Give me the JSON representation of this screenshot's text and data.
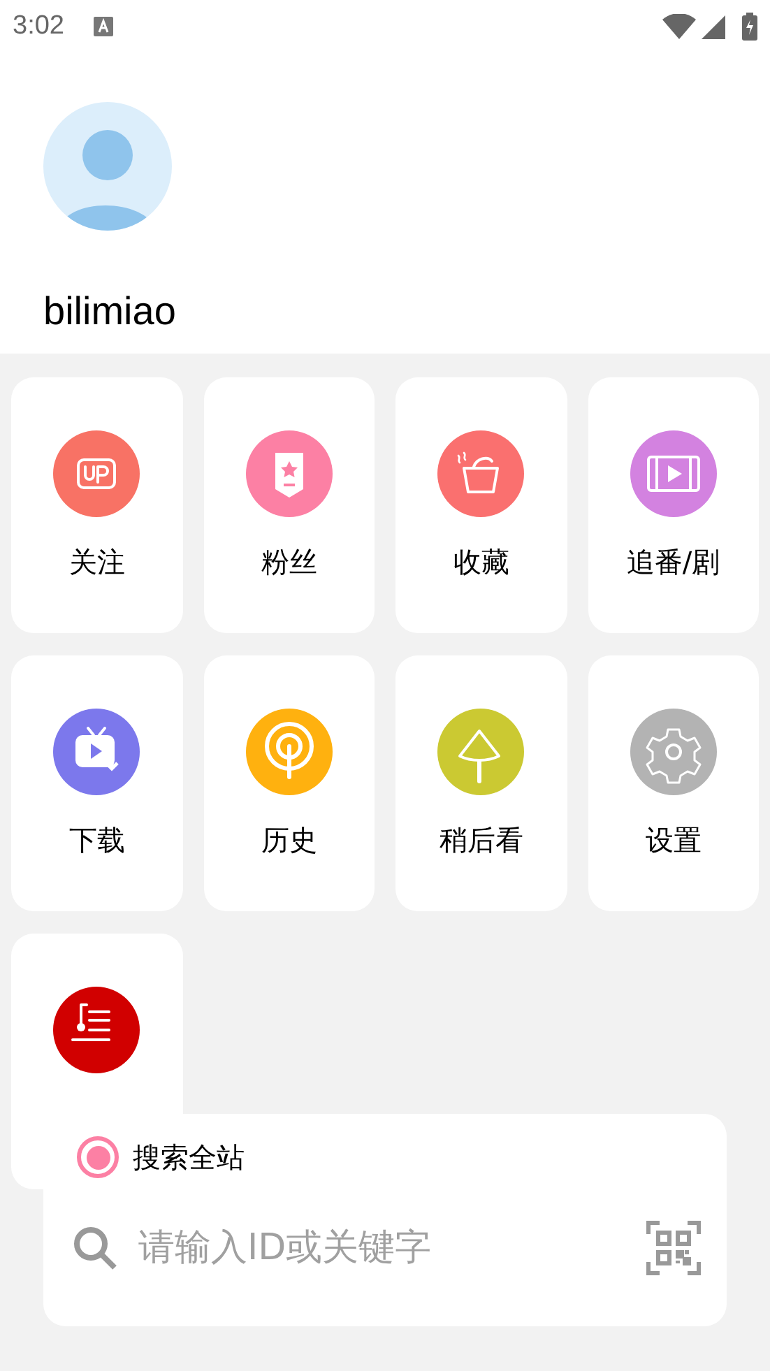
{
  "status_bar": {
    "time": "3:02"
  },
  "profile": {
    "name": "bilimiao"
  },
  "menu": [
    {
      "label": "关注",
      "kind": "up",
      "color": "#f87265"
    },
    {
      "label": "粉丝",
      "kind": "badge",
      "color": "#fc80a4"
    },
    {
      "label": "收藏",
      "kind": "bowl",
      "color": "#fa706f"
    },
    {
      "label": "追番/剧",
      "kind": "film",
      "color": "#d382e0"
    },
    {
      "label": "下载",
      "kind": "tv",
      "color": "#7c78ec"
    },
    {
      "label": "历史",
      "kind": "lollipop",
      "color": "#ffb10f"
    },
    {
      "label": "稍后看",
      "kind": "melon",
      "color": "#cbc932"
    },
    {
      "label": "设置",
      "kind": "gear",
      "color": "#b3b3b3"
    },
    {
      "kind": "lyrics",
      "color": "#d10000"
    }
  ],
  "search": {
    "scope": {
      "label": "搜索全站",
      "selected": true
    },
    "placeholder": "请输入ID或关键字"
  }
}
